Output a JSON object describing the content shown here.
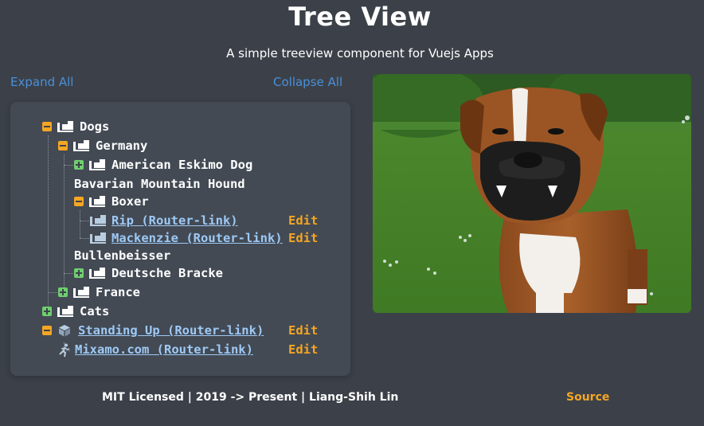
{
  "header": {
    "title": "Tree View",
    "subtitle": "A simple treeview component for Vuejs Apps"
  },
  "controls": {
    "expand_all": "Expand All",
    "collapse_all": "Collapse All"
  },
  "tree": {
    "dogs": "Dogs",
    "germany": "Germany",
    "american_eskimo": "American Eskimo Dog",
    "bavarian": "Bavarian Mountain Hound",
    "boxer": "Boxer",
    "rip": "Rip (Router-link)",
    "mackenzie": "Mackenzie (Router-link)",
    "bullenbeisser": "Bullenbeisser",
    "deutsche_bracke": "Deutsche Bracke",
    "france": "France",
    "cats": "Cats",
    "standing_up": "Standing Up (Router-link)",
    "mixamo": "Mixamo.com (Router-link)",
    "edit_label": "Edit"
  },
  "footer": {
    "text": "MIT Licensed | 2019 -> Present | Liang-Shih Lin",
    "source": "Source"
  },
  "colors": {
    "background": "#3c4149",
    "panel": "#434a54",
    "accent_orange": "#f5a623",
    "accent_green": "#6fcf6f",
    "link_blue": "#4a90d9"
  },
  "icons": {
    "toggle_expanded": "minus-square-icon",
    "toggle_collapsed": "plus-square-icon",
    "folder": "truck-loading-icon",
    "leaf_cube": "cube-icon",
    "leaf_runner": "running-person-icon"
  }
}
